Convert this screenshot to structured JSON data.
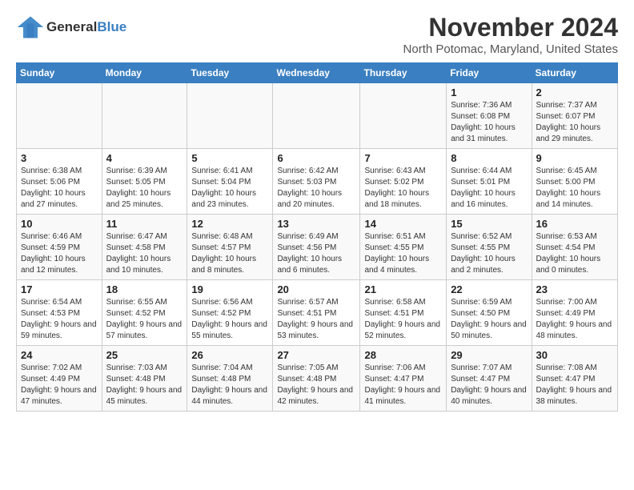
{
  "header": {
    "logo_general": "General",
    "logo_blue": "Blue",
    "month_title": "November 2024",
    "location": "North Potomac, Maryland, United States"
  },
  "days_of_week": [
    "Sunday",
    "Monday",
    "Tuesday",
    "Wednesday",
    "Thursday",
    "Friday",
    "Saturday"
  ],
  "weeks": [
    [
      {
        "day": "",
        "info": ""
      },
      {
        "day": "",
        "info": ""
      },
      {
        "day": "",
        "info": ""
      },
      {
        "day": "",
        "info": ""
      },
      {
        "day": "",
        "info": ""
      },
      {
        "day": "1",
        "info": "Sunrise: 7:36 AM\nSunset: 6:08 PM\nDaylight: 10 hours and 31 minutes."
      },
      {
        "day": "2",
        "info": "Sunrise: 7:37 AM\nSunset: 6:07 PM\nDaylight: 10 hours and 29 minutes."
      }
    ],
    [
      {
        "day": "3",
        "info": "Sunrise: 6:38 AM\nSunset: 5:06 PM\nDaylight: 10 hours and 27 minutes."
      },
      {
        "day": "4",
        "info": "Sunrise: 6:39 AM\nSunset: 5:05 PM\nDaylight: 10 hours and 25 minutes."
      },
      {
        "day": "5",
        "info": "Sunrise: 6:41 AM\nSunset: 5:04 PM\nDaylight: 10 hours and 23 minutes."
      },
      {
        "day": "6",
        "info": "Sunrise: 6:42 AM\nSunset: 5:03 PM\nDaylight: 10 hours and 20 minutes."
      },
      {
        "day": "7",
        "info": "Sunrise: 6:43 AM\nSunset: 5:02 PM\nDaylight: 10 hours and 18 minutes."
      },
      {
        "day": "8",
        "info": "Sunrise: 6:44 AM\nSunset: 5:01 PM\nDaylight: 10 hours and 16 minutes."
      },
      {
        "day": "9",
        "info": "Sunrise: 6:45 AM\nSunset: 5:00 PM\nDaylight: 10 hours and 14 minutes."
      }
    ],
    [
      {
        "day": "10",
        "info": "Sunrise: 6:46 AM\nSunset: 4:59 PM\nDaylight: 10 hours and 12 minutes."
      },
      {
        "day": "11",
        "info": "Sunrise: 6:47 AM\nSunset: 4:58 PM\nDaylight: 10 hours and 10 minutes."
      },
      {
        "day": "12",
        "info": "Sunrise: 6:48 AM\nSunset: 4:57 PM\nDaylight: 10 hours and 8 minutes."
      },
      {
        "day": "13",
        "info": "Sunrise: 6:49 AM\nSunset: 4:56 PM\nDaylight: 10 hours and 6 minutes."
      },
      {
        "day": "14",
        "info": "Sunrise: 6:51 AM\nSunset: 4:55 PM\nDaylight: 10 hours and 4 minutes."
      },
      {
        "day": "15",
        "info": "Sunrise: 6:52 AM\nSunset: 4:55 PM\nDaylight: 10 hours and 2 minutes."
      },
      {
        "day": "16",
        "info": "Sunrise: 6:53 AM\nSunset: 4:54 PM\nDaylight: 10 hours and 0 minutes."
      }
    ],
    [
      {
        "day": "17",
        "info": "Sunrise: 6:54 AM\nSunset: 4:53 PM\nDaylight: 9 hours and 59 minutes."
      },
      {
        "day": "18",
        "info": "Sunrise: 6:55 AM\nSunset: 4:52 PM\nDaylight: 9 hours and 57 minutes."
      },
      {
        "day": "19",
        "info": "Sunrise: 6:56 AM\nSunset: 4:52 PM\nDaylight: 9 hours and 55 minutes."
      },
      {
        "day": "20",
        "info": "Sunrise: 6:57 AM\nSunset: 4:51 PM\nDaylight: 9 hours and 53 minutes."
      },
      {
        "day": "21",
        "info": "Sunrise: 6:58 AM\nSunset: 4:51 PM\nDaylight: 9 hours and 52 minutes."
      },
      {
        "day": "22",
        "info": "Sunrise: 6:59 AM\nSunset: 4:50 PM\nDaylight: 9 hours and 50 minutes."
      },
      {
        "day": "23",
        "info": "Sunrise: 7:00 AM\nSunset: 4:49 PM\nDaylight: 9 hours and 48 minutes."
      }
    ],
    [
      {
        "day": "24",
        "info": "Sunrise: 7:02 AM\nSunset: 4:49 PM\nDaylight: 9 hours and 47 minutes."
      },
      {
        "day": "25",
        "info": "Sunrise: 7:03 AM\nSunset: 4:48 PM\nDaylight: 9 hours and 45 minutes."
      },
      {
        "day": "26",
        "info": "Sunrise: 7:04 AM\nSunset: 4:48 PM\nDaylight: 9 hours and 44 minutes."
      },
      {
        "day": "27",
        "info": "Sunrise: 7:05 AM\nSunset: 4:48 PM\nDaylight: 9 hours and 42 minutes."
      },
      {
        "day": "28",
        "info": "Sunrise: 7:06 AM\nSunset: 4:47 PM\nDaylight: 9 hours and 41 minutes."
      },
      {
        "day": "29",
        "info": "Sunrise: 7:07 AM\nSunset: 4:47 PM\nDaylight: 9 hours and 40 minutes."
      },
      {
        "day": "30",
        "info": "Sunrise: 7:08 AM\nSunset: 4:47 PM\nDaylight: 9 hours and 38 minutes."
      }
    ]
  ]
}
